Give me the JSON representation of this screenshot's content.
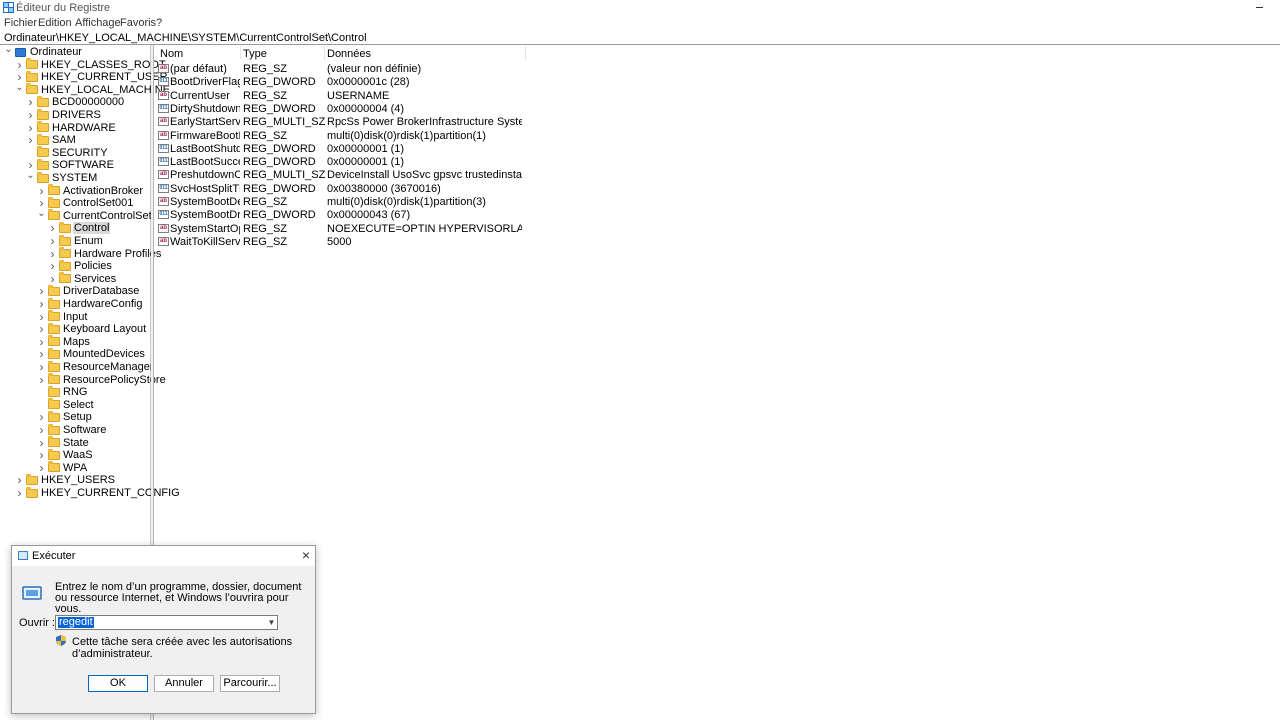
{
  "window": {
    "title": "Éditeur du Registre"
  },
  "menu": [
    "Fichier",
    "Edition",
    "Affichage",
    "Favoris",
    "?"
  ],
  "address": "Ordinateur\\HKEY_LOCAL_MACHINE\\SYSTEM\\CurrentControlSet\\Control",
  "tree": [
    {
      "label": "Ordinateur",
      "level": 0,
      "icon": "computer-icon",
      "expander": "open"
    },
    {
      "label": "HKEY_CLASSES_ROOT",
      "level": 1,
      "expander": "closed"
    },
    {
      "label": "HKEY_CURRENT_USER",
      "level": 1,
      "expander": "closed"
    },
    {
      "label": "HKEY_LOCAL_MACHINE",
      "level": 1,
      "expander": "open"
    },
    {
      "label": "BCD00000000",
      "level": 2,
      "expander": "closed"
    },
    {
      "label": "DRIVERS",
      "level": 2,
      "expander": "closed"
    },
    {
      "label": "HARDWARE",
      "level": 2,
      "expander": "closed"
    },
    {
      "label": "SAM",
      "level": 2,
      "expander": "closed"
    },
    {
      "label": "SECURITY",
      "level": 2,
      "expander": "none"
    },
    {
      "label": "SOFTWARE",
      "level": 2,
      "expander": "closed"
    },
    {
      "label": "SYSTEM",
      "level": 2,
      "expander": "open"
    },
    {
      "label": "ActivationBroker",
      "level": 3,
      "expander": "closed"
    },
    {
      "label": "ControlSet001",
      "level": 3,
      "expander": "closed"
    },
    {
      "label": "CurrentControlSet",
      "level": 3,
      "expander": "open"
    },
    {
      "label": "Control",
      "level": 4,
      "expander": "closed",
      "selected": true
    },
    {
      "label": "Enum",
      "level": 4,
      "expander": "closed"
    },
    {
      "label": "Hardware Profiles",
      "level": 4,
      "expander": "closed"
    },
    {
      "label": "Policies",
      "level": 4,
      "expander": "closed"
    },
    {
      "label": "Services",
      "level": 4,
      "expander": "closed"
    },
    {
      "label": "DriverDatabase",
      "level": 3,
      "expander": "closed"
    },
    {
      "label": "HardwareConfig",
      "level": 3,
      "expander": "closed"
    },
    {
      "label": "Input",
      "level": 3,
      "expander": "closed"
    },
    {
      "label": "Keyboard Layout",
      "level": 3,
      "expander": "closed"
    },
    {
      "label": "Maps",
      "level": 3,
      "expander": "closed"
    },
    {
      "label": "MountedDevices",
      "level": 3,
      "expander": "closed"
    },
    {
      "label": "ResourceManager",
      "level": 3,
      "expander": "closed"
    },
    {
      "label": "ResourcePolicyStore",
      "level": 3,
      "expander": "closed"
    },
    {
      "label": "RNG",
      "level": 3,
      "expander": "none"
    },
    {
      "label": "Select",
      "level": 3,
      "expander": "none"
    },
    {
      "label": "Setup",
      "level": 3,
      "expander": "closed"
    },
    {
      "label": "Software",
      "level": 3,
      "expander": "closed"
    },
    {
      "label": "State",
      "level": 3,
      "expander": "closed"
    },
    {
      "label": "WaaS",
      "level": 3,
      "expander": "closed"
    },
    {
      "label": "WPA",
      "level": 3,
      "expander": "closed"
    },
    {
      "label": "HKEY_USERS",
      "level": 1,
      "expander": "closed"
    },
    {
      "label": "HKEY_CURRENT_CONFIG",
      "level": 1,
      "expander": "closed"
    }
  ],
  "columns": {
    "name": "Nom",
    "type": "Type",
    "data": "Données"
  },
  "values": [
    {
      "name": "(par défaut)",
      "type": "REG_SZ",
      "data": "(valeur non définie)",
      "icon": "string-value-icon"
    },
    {
      "name": "BootDriverFlags",
      "type": "REG_DWORD",
      "data": "0x0000001c (28)",
      "icon": "binary-value-icon"
    },
    {
      "name": "CurrentUser",
      "type": "REG_SZ",
      "data": "USERNAME",
      "icon": "string-value-icon"
    },
    {
      "name": "DirtyShutdownC...",
      "type": "REG_DWORD",
      "data": "0x00000004 (4)",
      "icon": "binary-value-icon"
    },
    {
      "name": "EarlyStartServices",
      "type": "REG_MULTI_SZ",
      "data": "RpcSs Power BrokerInfrastructure SystemEventsBr...",
      "icon": "string-value-icon"
    },
    {
      "name": "FirmwareBootD...",
      "type": "REG_SZ",
      "data": "multi(0)disk(0)rdisk(1)partition(1)",
      "icon": "string-value-icon"
    },
    {
      "name": "LastBootShutdo...",
      "type": "REG_DWORD",
      "data": "0x00000001 (1)",
      "icon": "binary-value-icon"
    },
    {
      "name": "LastBootSuccee...",
      "type": "REG_DWORD",
      "data": "0x00000001 (1)",
      "icon": "binary-value-icon"
    },
    {
      "name": "PreshutdownOr...",
      "type": "REG_MULTI_SZ",
      "data": "DeviceInstall UsoSvc gpsvc trustedinstaller",
      "icon": "string-value-icon"
    },
    {
      "name": "SvcHostSplitThr...",
      "type": "REG_DWORD",
      "data": "0x00380000 (3670016)",
      "icon": "binary-value-icon"
    },
    {
      "name": "SystemBootDevi...",
      "type": "REG_SZ",
      "data": "multi(0)disk(0)rdisk(1)partition(3)",
      "icon": "string-value-icon"
    },
    {
      "name": "SystemBootDriv...",
      "type": "REG_DWORD",
      "data": "0x00000043 (67)",
      "icon": "binary-value-icon"
    },
    {
      "name": "SystemStartOpti...",
      "type": "REG_SZ",
      "data": " NOEXECUTE=OPTIN  HYPERVISORLAUNCHTYPE=...",
      "icon": "string-value-icon"
    },
    {
      "name": "WaitToKillServic...",
      "type": "REG_SZ",
      "data": "5000",
      "icon": "string-value-icon"
    }
  ],
  "run_dialog": {
    "title": "Exécuter",
    "description": "Entrez le nom d’un programme, dossier, document ou ressource Internet, et Windows l’ouvrira pour vous.",
    "open_label": "Ouvrir :",
    "open_value": "regedit",
    "admin_note": "Cette tâche sera créée avec les autorisations d’administrateur.",
    "ok_label": "OK",
    "cancel_label": "Annuler",
    "browse_label": "Parcourir..."
  },
  "colors": {
    "folder": "#f6c94f",
    "selection": "#0a64d6",
    "tree_selected": "#d9d9d9"
  }
}
